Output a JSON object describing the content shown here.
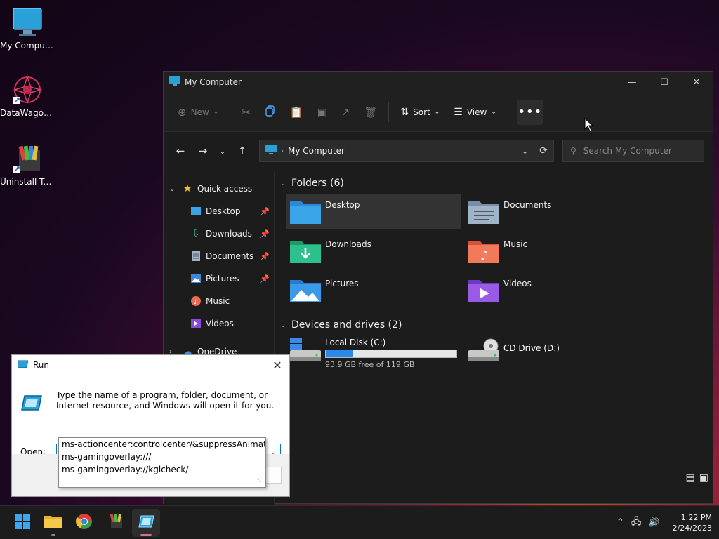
{
  "desktop": {
    "icons": [
      {
        "label": "My Computer"
      },
      {
        "label": "DataWagon..."
      },
      {
        "label": "Uninstall Tool"
      }
    ]
  },
  "explorer": {
    "title": "My Computer",
    "toolbar": {
      "new_label": "New",
      "sort_label": "Sort",
      "view_label": "View",
      "more_label": "•••"
    },
    "address": {
      "crumb": "My Computer"
    },
    "search": {
      "placeholder": "Search My Computer"
    },
    "sidebar": {
      "quick_access": "Quick access",
      "items": [
        {
          "label": "Desktop"
        },
        {
          "label": "Downloads"
        },
        {
          "label": "Documents"
        },
        {
          "label": "Pictures"
        },
        {
          "label": "Music"
        },
        {
          "label": "Videos"
        }
      ],
      "onedrive": "OneDrive"
    },
    "folders_header": "Folders (6)",
    "folders": [
      {
        "name": "Desktop"
      },
      {
        "name": "Documents"
      },
      {
        "name": "Downloads"
      },
      {
        "name": "Music"
      },
      {
        "name": "Pictures"
      },
      {
        "name": "Videos"
      }
    ],
    "drives_header": "Devices and drives (2)",
    "drives": [
      {
        "name": "Local Disk (C:)",
        "free_text": "93.9 GB free of 119 GB",
        "used_fraction": 0.21
      },
      {
        "name": "CD Drive (D:)"
      }
    ]
  },
  "run_dialog": {
    "title": "Run",
    "description": "Type the name of a program, folder, document, or Internet resource, and Windows will open it for you.",
    "open_label": "Open:",
    "input_value": "ms",
    "suggestions": [
      "ms-actioncenter:controlcenter/&suppressAnimations=",
      "ms-gamingoverlay:///",
      "ms-gamingoverlay://kglcheck/"
    ]
  },
  "taskbar": {
    "time": "1:22 PM",
    "date": "2/24/2023"
  },
  "colors": {
    "accent": "#0078d4",
    "drive_bar": "#2a8ae8"
  }
}
